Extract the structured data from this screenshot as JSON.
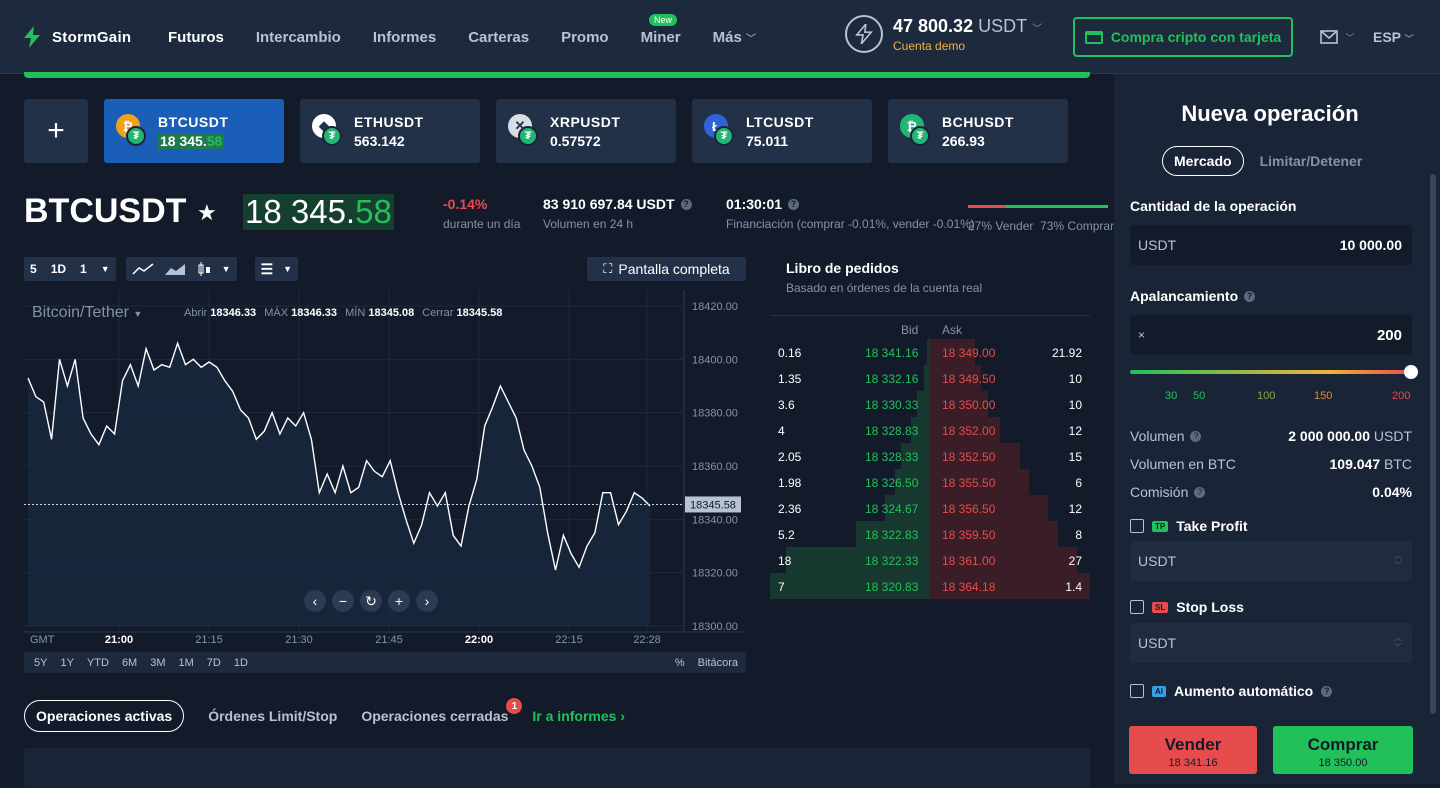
{
  "brand": {
    "name": "StormGain"
  },
  "nav": [
    {
      "label": "Futuros",
      "active": true
    },
    {
      "label": "Intercambio"
    },
    {
      "label": "Informes"
    },
    {
      "label": "Carteras"
    },
    {
      "label": "Promo"
    },
    {
      "label": "Miner",
      "badge": "New"
    },
    {
      "label": "Más"
    }
  ],
  "account": {
    "balance": "47 800.32",
    "currency": "USDT",
    "type": "Cuenta demo"
  },
  "buy_crypto_button": "Compra cripto con tarjeta",
  "language": "ESP",
  "tickers": [
    {
      "symbol": "BTCUSDT",
      "price": "18 345.",
      "price_hl": "58",
      "icon": "bitcoin-icon",
      "color": "#f0a31a",
      "glyph": "₿",
      "selected": true
    },
    {
      "symbol": "ETHUSDT",
      "price": "563.142",
      "icon": "ethereum-icon",
      "color": "#ffffff",
      "glyph": "◆"
    },
    {
      "symbol": "XRPUSDT",
      "price": "0.57572",
      "icon": "xrp-icon",
      "color": "#d8dde6",
      "glyph": "✕"
    },
    {
      "symbol": "LTCUSDT",
      "price": "75.011",
      "icon": "litecoin-icon",
      "color": "#2f63d8",
      "glyph": "Ł"
    },
    {
      "symbol": "BCHUSDT",
      "price": "266.93",
      "icon": "bitcoincash-icon",
      "color": "#22b573",
      "glyph": "₿"
    }
  ],
  "main": {
    "symbol": "BTCUSDT",
    "price_main": "18 345.",
    "price_decimals": "58",
    "change": "-0.14%",
    "change_label": "durante un día",
    "volume": "83 910 697.84 USDT",
    "volume_label": "Volumen en 24 h",
    "funding_time": "01:30:01",
    "funding_label": "Financiación (comprar -0.01%, vender -0.01%)",
    "sentiment_sell": "27% Vender",
    "sentiment_buy": "73% Comprar",
    "sell_pct": 27
  },
  "toolbar": {
    "interval_a": "5",
    "interval_b": "1D",
    "interval_c": "1",
    "fullscreen": "Pantalla completa"
  },
  "chart": {
    "pair": "Bitcoin/Tether",
    "ohlc": {
      "open_label": "Abrir",
      "open": "18346.33",
      "high_label": "MÁX",
      "high": "18346.33",
      "low_label": "MÍN",
      "low": "18345.08",
      "close_label": "Cerrar",
      "close": "18345.58"
    },
    "current_price_label": "18345.58",
    "timezone": "GMT",
    "periods": [
      "5Y",
      "1Y",
      "YTD",
      "6M",
      "3M",
      "1M",
      "7D",
      "1D"
    ],
    "right_labels": [
      "%",
      "Bitácora"
    ]
  },
  "chart_data": {
    "type": "line",
    "series": [
      {
        "values": [
          18393,
          18386,
          18384,
          18370,
          18400,
          18390,
          18400,
          18378,
          18372,
          18368,
          18375,
          18372,
          18392,
          18398,
          18390,
          18404,
          18396,
          18398,
          18397,
          18406,
          18398,
          18400,
          18397,
          18399,
          18397,
          18392,
          18388,
          18381,
          18378,
          18370,
          18373,
          18380,
          18372,
          18378,
          18375,
          18380,
          18370,
          18350,
          18357,
          18350,
          18360,
          18350,
          18352,
          18362,
          18358,
          18356,
          18362,
          18350,
          18340,
          18331,
          18338,
          18350,
          18345,
          18350,
          18334,
          18330,
          18345,
          18355,
          18375,
          18382,
          18390,
          18384,
          18378,
          18366,
          18360,
          18352,
          18335,
          18321,
          18334,
          18327,
          18322,
          18330,
          18335,
          18350,
          18350,
          18338,
          18343,
          18350,
          18348,
          18345
        ]
      }
    ],
    "x_ticks": [
      "21:00",
      "21:15",
      "21:30",
      "21:45",
      "22:00",
      "22:15",
      "22:28"
    ],
    "y_ticks": [
      "18420.00",
      "18400.00",
      "18380.00",
      "18360.00",
      "18340.00",
      "18320.00",
      "18300.00"
    ],
    "ylim": [
      18300,
      18420
    ]
  },
  "orderbook": {
    "title": "Libro de pedidos",
    "subtitle": "Basado en órdenes de la cuenta real",
    "col_bid": "Bid",
    "col_ask": "Ask",
    "rows": [
      {
        "bid_qty": "0.16",
        "bid": "18 341.16",
        "ask": "18 349.00",
        "ask_qty": "21.92",
        "bid_depth": 0.02,
        "ask_depth": 0.28
      },
      {
        "bid_qty": "1.35",
        "bid": "18 332.16",
        "ask": "18 349.50",
        "ask_qty": "10",
        "bid_depth": 0.04,
        "ask_depth": 0.32
      },
      {
        "bid_qty": "3.6",
        "bid": "18 330.33",
        "ask": "18 350.00",
        "ask_qty": "10",
        "bid_depth": 0.08,
        "ask_depth": 0.36
      },
      {
        "bid_qty": "4",
        "bid": "18 328.83",
        "ask": "18 352.00",
        "ask_qty": "12",
        "bid_depth": 0.12,
        "ask_depth": 0.44
      },
      {
        "bid_qty": "2.05",
        "bid": "18 328.33",
        "ask": "18 352.50",
        "ask_qty": "15",
        "bid_depth": 0.18,
        "ask_depth": 0.56
      },
      {
        "bid_qty": "1.98",
        "bid": "18 326.50",
        "ask": "18 355.50",
        "ask_qty": "6",
        "bid_depth": 0.22,
        "ask_depth": 0.62
      },
      {
        "bid_qty": "2.36",
        "bid": "18 324.67",
        "ask": "18 356.50",
        "ask_qty": "12",
        "bid_depth": 0.28,
        "ask_depth": 0.74
      },
      {
        "bid_qty": "5.2",
        "bid": "18 322.83",
        "ask": "18 359.50",
        "ask_qty": "8",
        "bid_depth": 0.46,
        "ask_depth": 0.8
      },
      {
        "bid_qty": "18",
        "bid": "18 322.33",
        "ask": "18 361.00",
        "ask_qty": "27",
        "bid_depth": 0.9,
        "ask_depth": 0.92
      },
      {
        "bid_qty": "7",
        "bid": "18 320.83",
        "ask": "18 364.18",
        "ask_qty": "1.4",
        "bid_depth": 1.0,
        "ask_depth": 1.0
      }
    ]
  },
  "bottom_tabs": {
    "active": "Operaciones activas",
    "limit": "Órdenes Limit/Stop",
    "closed": "Operaciones cerradas",
    "closed_badge": "1",
    "reports": "Ir a informes ›"
  },
  "trade": {
    "title": "Nueva operación",
    "mode_market": "Mercado",
    "mode_limit": "Limitar/Detener",
    "amount_label": "Cantidad de la operación",
    "amount_currency": "USDT",
    "amount_value": "10 000.00",
    "leverage_label": "Apalancamiento",
    "leverage_prefix": "×",
    "leverage_value": "200",
    "leverage_level": 200,
    "leverage_ticks": [
      "30",
      "50",
      "100",
      "150",
      "200"
    ],
    "volume_label": "Volumen",
    "volume_value": "2 000 000.00",
    "volume_unit": "USDT",
    "volume_btc_label": "Volumen en BTC",
    "volume_btc_value": "109.047",
    "volume_btc_unit": "BTC",
    "commission_label": "Comisión",
    "commission_value": "0.04%",
    "take_profit_tag": "TP",
    "take_profit_label": "Take Profit",
    "take_profit_placeholder": "USDT",
    "stop_loss_tag": "SL",
    "stop_loss_label": "Stop Loss",
    "stop_loss_placeholder": "USDT",
    "auto_tag": "AI",
    "auto_label": "Aumento automático",
    "sell_label": "Vender",
    "sell_price": "18 341.16",
    "buy_label": "Comprar",
    "buy_price": "18 350.00"
  },
  "colors": {
    "green": "#22c05a",
    "red": "#e64c4c",
    "accent_blue": "#1a5eb8",
    "bg": "#131b2b"
  }
}
